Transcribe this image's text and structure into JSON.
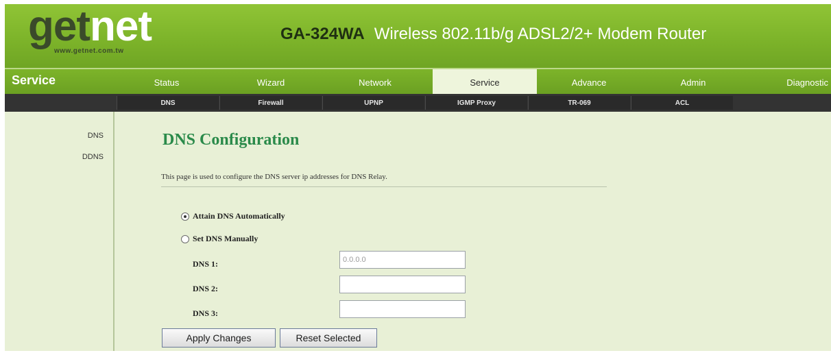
{
  "header": {
    "logo_get": "get",
    "logo_net": "net",
    "logo_url": "www.getnet.com.tw",
    "model_code": "GA-324WA",
    "model_desc": "Wireless 802.11b/g ADSL2/2+ Modem Router"
  },
  "section_title": "Service",
  "nav": {
    "tabs": [
      {
        "label": "Status"
      },
      {
        "label": "Wizard"
      },
      {
        "label": "Network"
      },
      {
        "label": "Service"
      },
      {
        "label": "Advance"
      },
      {
        "label": "Admin"
      },
      {
        "label": "Diagnostic"
      }
    ],
    "active": "Service"
  },
  "subnav": {
    "tabs": [
      {
        "label": "DNS"
      },
      {
        "label": "Firewall"
      },
      {
        "label": "UPNP"
      },
      {
        "label": "IGMP Proxy"
      },
      {
        "label": "TR-069"
      },
      {
        "label": "ACL"
      }
    ]
  },
  "sidebar": {
    "items": [
      {
        "label": "DNS"
      },
      {
        "label": "DDNS"
      }
    ]
  },
  "main": {
    "title": "DNS Configuration",
    "description": "This page is used to configure the DNS server ip addresses for DNS Relay.",
    "radio_auto": "Attain DNS Automatically",
    "radio_manual": "Set DNS Manually",
    "selected_mode": "auto",
    "dns1_label": "DNS 1:",
    "dns2_label": "DNS 2:",
    "dns3_label": "DNS 3:",
    "dns1_value": "0.0.0.0",
    "dns2_value": "",
    "dns3_value": "",
    "apply_label": "Apply Changes",
    "reset_label": "Reset Selected"
  },
  "colors": {
    "brand_green": "#7db42a",
    "title_green": "#2a8a4a",
    "subnav_bg": "#333333",
    "page_bg": "#e8f0d6"
  }
}
